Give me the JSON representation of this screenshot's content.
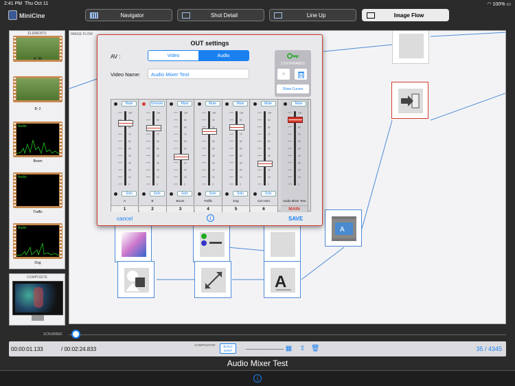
{
  "status_bar": {
    "time": "2:41 PM",
    "date": "Thu Oct 11",
    "battery": "100%"
  },
  "app": {
    "name": "MiniCine"
  },
  "tabs": [
    {
      "label": "Navigator",
      "active": false
    },
    {
      "label": "Shot Detail",
      "active": false
    },
    {
      "label": "Line Up",
      "active": false
    },
    {
      "label": "Image Flow",
      "active": true
    }
  ],
  "elements_panel": {
    "title": "ELEMENTS",
    "items": [
      {
        "label": "A: 35",
        "kind": "video"
      },
      {
        "label": "B: 2",
        "kind": "video"
      },
      {
        "label": "Boom",
        "kind": "audio",
        "tag": "Audio"
      },
      {
        "label": "Traffic",
        "kind": "audio",
        "tag": "Audio"
      },
      {
        "label": "Dog",
        "kind": "audio",
        "tag": "Audio"
      }
    ]
  },
  "composite_panel": {
    "title": "COMPOSITE"
  },
  "flow": {
    "title": "IMAGE FLOW"
  },
  "modal": {
    "title": "OUT settings",
    "av_label": "AV :",
    "av_options": [
      "Video",
      "Audio"
    ],
    "av_selected": "Audio",
    "video_name_label": "Video Name:",
    "video_name_value": "Audio Mixer Test",
    "keyframes_label": "2 KEYFRAMES",
    "show_curves_label": "Show Curves",
    "cancel_label": "cancel",
    "save_label": "SAVE",
    "scale_marks": [
      "100",
      "90",
      "80",
      "70",
      "60",
      "50",
      "40",
      "30",
      "20",
      "10",
      "0"
    ],
    "channels": [
      {
        "name": "A",
        "num": "1",
        "mute": "Mute",
        "solo": "Solo",
        "level": 84,
        "muted": false
      },
      {
        "name": "B",
        "num": "2",
        "mute": "Unmute",
        "solo": "Solo",
        "level": 77,
        "muted": true
      },
      {
        "name": "Boom",
        "num": "3",
        "mute": "Mute",
        "solo": "Solo",
        "level": 38,
        "muted": false
      },
      {
        "name": "Traffic",
        "num": "4",
        "mute": "Mute",
        "solo": "Solo",
        "level": 73,
        "muted": false
      },
      {
        "name": "Dog",
        "num": "5",
        "mute": "Mute",
        "solo": "Solo",
        "level": 78,
        "muted": false
      },
      {
        "name": "Car Horn",
        "num": "6",
        "mute": "Mute",
        "solo": "Solo",
        "level": 29,
        "muted": false
      }
    ],
    "main_channel": {
      "name": "Audio Mixer Test",
      "num": "MAIN",
      "mute": "Mute",
      "level": 88
    }
  },
  "scrubber": {
    "label": "SCRUBBER"
  },
  "bottom_bar": {
    "current_time": "00:00:01.133",
    "total_time": "/ 00:02:24.833",
    "compositor_label": "COMPOSITOR",
    "build_shot_label": "BUILD SHOT",
    "frame_counter": "35 / 4345"
  },
  "shot_title": "Audio Mixer Test",
  "colors": {
    "accent": "#1a80f0",
    "out_node": "#d23a2a",
    "film_border": "#c68a4f"
  }
}
